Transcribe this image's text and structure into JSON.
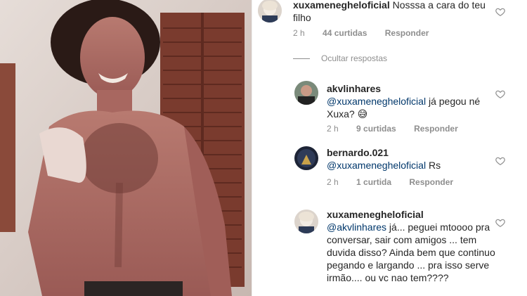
{
  "photo": {
    "alt_icon": "shirtless-man-photo"
  },
  "main_comment": {
    "username": "xuxamenegheloficial",
    "text": "Nosssa a cara do teu filho",
    "time": "2 h",
    "likes": "44 curtidas",
    "reply_label": "Responder"
  },
  "hide_replies_label": "Ocultar respostas",
  "replies": [
    {
      "username": "akvlinhares",
      "mention": "@xuxamenegheloficial",
      "text": "já pegou né Xuxa? 😅",
      "time": "2 h",
      "likes": "9 curtidas",
      "reply_label": "Responder"
    },
    {
      "username": "bernardo.021",
      "mention": "@xuxamenegheloficial",
      "text": "Rs",
      "time": "2 h",
      "likes": "1 curtida",
      "reply_label": "Responder"
    },
    {
      "username": "xuxamenegheloficial",
      "mention": "@akvlinhares",
      "text": "já... peguei mtoooo pra conversar, sair com amigos ... tem duvida disso? Ainda bem que continuo pegando e largando ... pra isso serve irmão.... ou vc nao tem????"
    }
  ],
  "colors": {
    "text": "#262626",
    "muted": "#8e8e8e",
    "mention": "#00376b"
  }
}
